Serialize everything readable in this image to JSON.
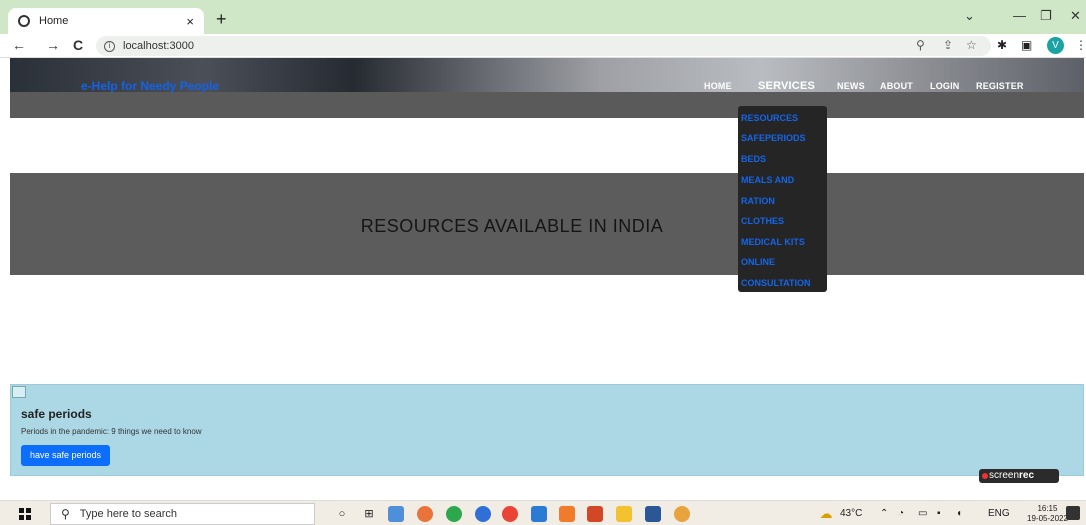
{
  "browser": {
    "tab_title": "Home",
    "tab_close": "×",
    "new_tab": "+",
    "url": "localhost:3000",
    "back": "←",
    "forward": "→",
    "reload": "C",
    "minimize": "—",
    "restore": "❐",
    "close": "✕",
    "tab_search": "⌄",
    "profile_initial": "V",
    "menu": "⋮",
    "zoom_icon": "⚲",
    "share_icon": "⇪",
    "bookmark_icon": "☆",
    "extensions_icon": "✱",
    "sidepanel_icon": "▣"
  },
  "site": {
    "brand": "e-Help for Needy People",
    "nav": {
      "home": "HOME",
      "services": "SERVICES",
      "news": "NEWS",
      "about": "ABOUT",
      "login": "LOGIN",
      "register": "REGISTER"
    },
    "dropdown": [
      "RESOURCES",
      "SAFEPERIODS",
      "BEDS",
      "MEALS AND",
      "RATION",
      "CLOTHES",
      "MEDICAL KITS",
      "ONLINE",
      "CONSULTATION"
    ],
    "banner_title": "RESOURCES AVAILABLE IN INDIA",
    "card": {
      "title": "safe periods",
      "text": "Periods in the pandemic: 9 things we need to know",
      "button": "have safe periods"
    }
  },
  "overlay": {
    "screenrec_light": "screen",
    "screenrec_bold": "rec"
  },
  "taskbar": {
    "search_placeholder": "Type here to search",
    "weather": "43°C",
    "lang": "ENG",
    "time": "16:15",
    "date": "19-05-2022"
  },
  "colors": {
    "tabbar": "#cfe7c7",
    "brand": "#1463e6",
    "dropdown_link": "#1565e8",
    "card_bg": "#acd8e6",
    "button": "#0d6efd"
  }
}
